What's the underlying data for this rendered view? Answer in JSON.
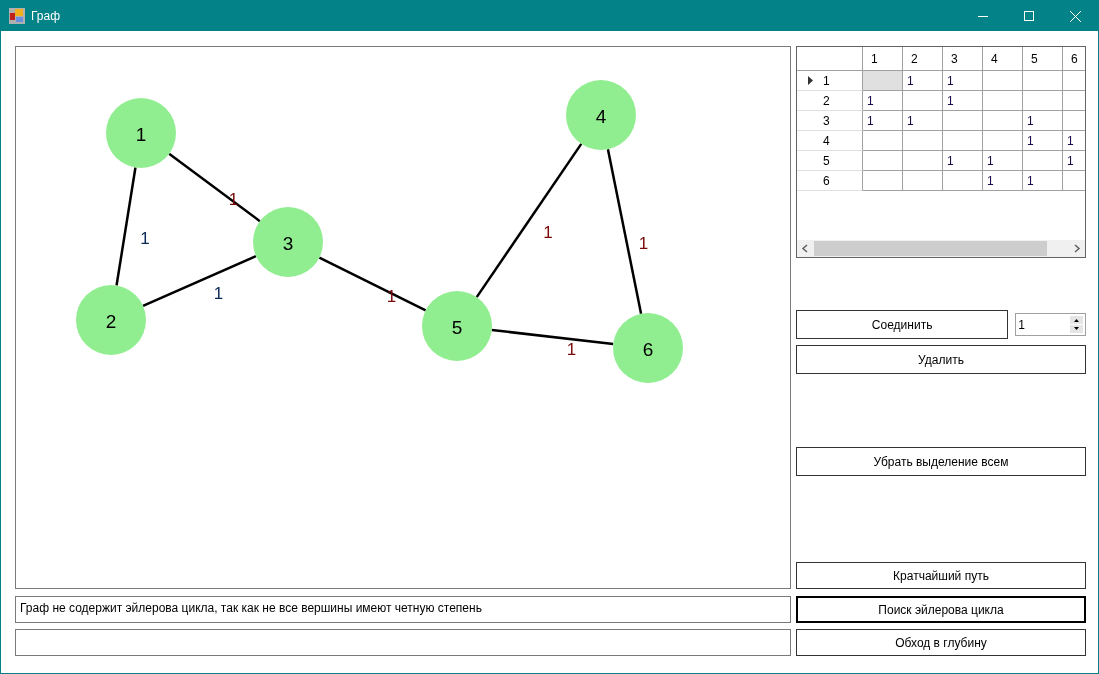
{
  "window": {
    "title": "Граф"
  },
  "graph": {
    "nodes": [
      {
        "label": "1"
      },
      {
        "label": "2"
      },
      {
        "label": "3"
      },
      {
        "label": "4"
      },
      {
        "label": "5"
      },
      {
        "label": "6"
      }
    ],
    "edges": [
      {
        "weight": "1",
        "color": "#0a2a55"
      },
      {
        "weight": "1",
        "color": "#7a0a0a"
      },
      {
        "weight": "1",
        "color": "#0a2a55"
      },
      {
        "weight": "1",
        "color": "#7a0a0a"
      },
      {
        "weight": "1",
        "color": "#7a0a0a"
      },
      {
        "weight": "1",
        "color": "#7a0a0a"
      },
      {
        "weight": "1",
        "color": "#7a0a0a"
      }
    ]
  },
  "matrix": {
    "columns": [
      "1",
      "2",
      "3",
      "4",
      "5",
      "6"
    ],
    "rows": [
      {
        "header": "1",
        "current": true,
        "cells": [
          {
            "selected": true
          },
          {
            "text": "1",
            "selected": false
          },
          {
            "text": "1",
            "selected": false
          },
          {
            "selected": false
          },
          {
            "selected": false
          },
          {
            "selected": false
          }
        ]
      },
      {
        "header": "2",
        "current": false,
        "cells": [
          {
            "text": "1",
            "selected": false
          },
          {
            "selected": false
          },
          {
            "text": "1",
            "selected": false
          },
          {
            "selected": false
          },
          {
            "selected": false
          },
          {
            "selected": false
          }
        ]
      },
      {
        "header": "3",
        "current": false,
        "cells": [
          {
            "text": "1",
            "selected": false
          },
          {
            "text": "1",
            "selected": false
          },
          {
            "selected": false
          },
          {
            "selected": false
          },
          {
            "text": "1",
            "selected": false
          },
          {
            "selected": false
          }
        ]
      },
      {
        "header": "4",
        "current": false,
        "cells": [
          {
            "selected": false
          },
          {
            "selected": false
          },
          {
            "selected": false
          },
          {
            "selected": false
          },
          {
            "text": "1",
            "selected": false
          },
          {
            "text": "1",
            "selected": false
          }
        ]
      },
      {
        "header": "5",
        "current": false,
        "cells": [
          {
            "selected": false
          },
          {
            "selected": false
          },
          {
            "text": "1",
            "selected": false
          },
          {
            "text": "1",
            "selected": false
          },
          {
            "selected": false
          },
          {
            "text": "1",
            "selected": false
          }
        ]
      },
      {
        "header": "6",
        "current": false,
        "cells": [
          {
            "selected": false
          },
          {
            "selected": false
          },
          {
            "selected": false
          },
          {
            "text": "1",
            "selected": false
          },
          {
            "text": "1",
            "selected": false
          },
          {
            "selected": false
          }
        ]
      }
    ]
  },
  "connect_button": {
    "label": "Соединить"
  },
  "weight_spinner": {
    "value": "1"
  },
  "delete_button": {
    "label": "Удалить"
  },
  "clear_selection_button": {
    "label": "Убрать выделение всем"
  },
  "shortest_path_button": {
    "label": "Кратчайший путь",
    "focused": false
  },
  "euler_button": {
    "label": "Поиск эйлерова цикла",
    "focused": true
  },
  "dfs_button": {
    "label": "Обход в глубину",
    "focused": false
  },
  "result_field": {
    "value": "Граф не содержит эйлерова цикла, так как не все вершины имеют четную степень"
  }
}
